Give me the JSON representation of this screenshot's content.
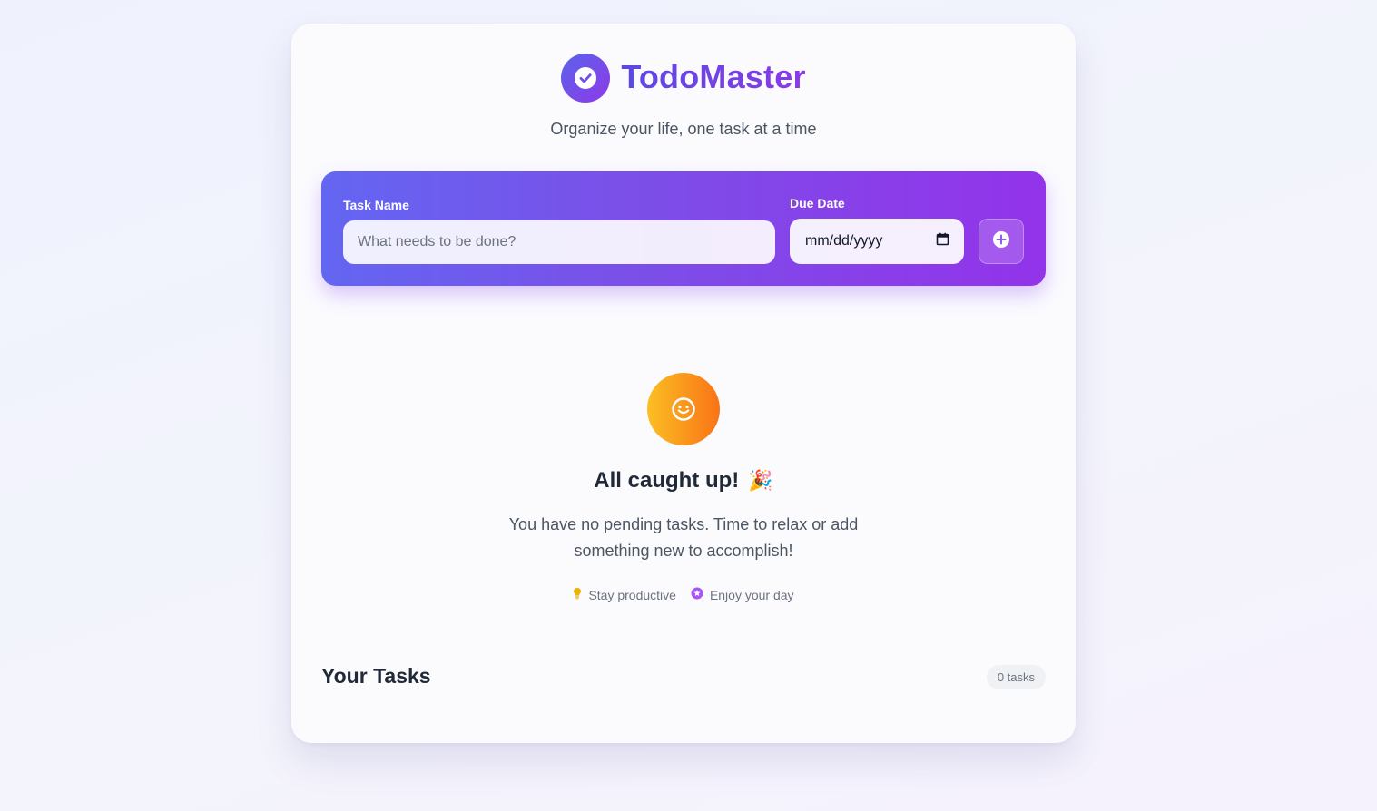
{
  "app": {
    "title": "TodoMaster",
    "subtitle": "Organize your life, one task at a time"
  },
  "form": {
    "task_label": "Task Name",
    "task_placeholder": "What needs to be done?",
    "date_label": "Due Date",
    "date_value": "mm/dd/yyyy",
    "add_icon": "plus-circle-icon"
  },
  "empty_state": {
    "icon": "smile-icon",
    "title": "All caught up!",
    "title_emoji": "🎉",
    "description": "You have no pending tasks. Time to relax or add something new to accomplish!",
    "tips": [
      {
        "icon": "lightbulb-icon",
        "label": "Stay productive",
        "color": "#eab308"
      },
      {
        "icon": "star-icon",
        "label": "Enjoy your day",
        "color": "#a855f7"
      }
    ]
  },
  "tasks": {
    "heading": "Your Tasks",
    "count_label": "0 tasks"
  },
  "colors": {
    "primary_start": "#6366f1",
    "primary_end": "#9333ea",
    "accent_start": "#fbbf24",
    "accent_end": "#f97316"
  }
}
